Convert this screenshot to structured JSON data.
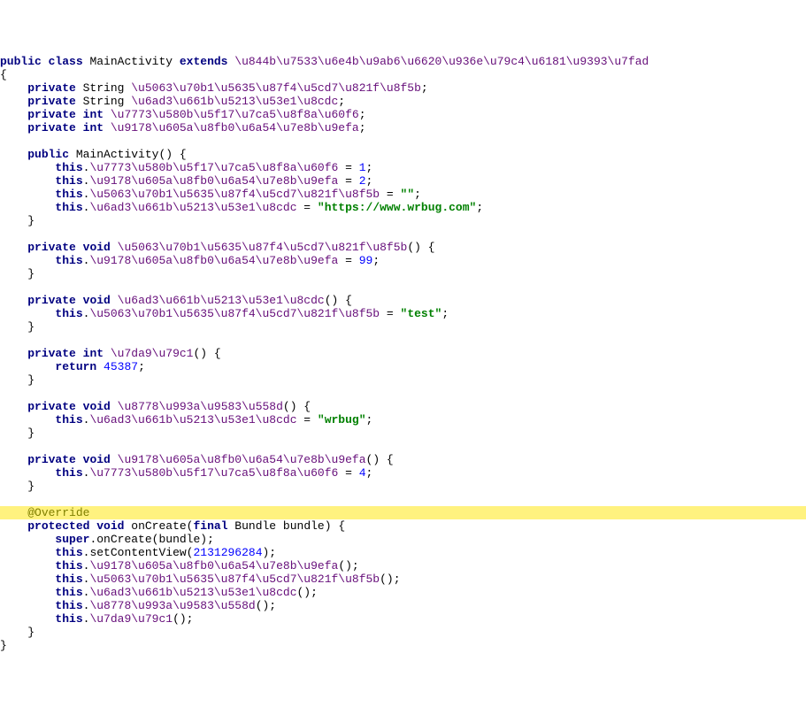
{
  "line1": {
    "kw1": "public",
    "kw2": "class",
    "name": " MainActivity ",
    "kw3": "extends",
    "sp": " ",
    "parent": "\\u844b\\u7533\\u6e4b\\u9ab6\\u6620\\u936e\\u79c4\\u6181\\u9393\\u7fad"
  },
  "line2": {
    "t": "{"
  },
  "line3": {
    "ind": "    ",
    "kw": "private",
    "sp": " String ",
    "id": "\\u5063\\u70b1\\u5635\\u87f4\\u5cd7\\u821f\\u8f5b",
    "end": ";"
  },
  "line4": {
    "ind": "    ",
    "kw": "private",
    "sp": " String ",
    "id": "\\u6ad3\\u661b\\u5213\\u53e1\\u8cdc",
    "end": ";"
  },
  "line5": {
    "ind": "    ",
    "kw1": "private",
    "sp1": " ",
    "kw2": "int",
    "sp2": " ",
    "id": "\\u7773\\u580b\\u5f17\\u7ca5\\u8f8a\\u60f6",
    "end": ";"
  },
  "line6": {
    "ind": "    ",
    "kw1": "private",
    "sp1": " ",
    "kw2": "int",
    "sp2": " ",
    "id": "\\u9178\\u605a\\u8fb0\\u6a54\\u7e8b\\u9efa",
    "end": ";"
  },
  "blank1": " ",
  "line8": {
    "ind": "    ",
    "kw": "public",
    "rest": " MainActivity() {"
  },
  "line9": {
    "ind": "        ",
    "kw": "this",
    "dot": ".",
    "id": "\\u7773\\u580b\\u5f17\\u7ca5\\u8f8a\\u60f6",
    "mid": " = ",
    "num": "1",
    "end": ";"
  },
  "line10": {
    "ind": "        ",
    "kw": "this",
    "dot": ".",
    "id": "\\u9178\\u605a\\u8fb0\\u6a54\\u7e8b\\u9efa",
    "mid": " = ",
    "num": "2",
    "end": ";"
  },
  "line11": {
    "ind": "        ",
    "kw": "this",
    "dot": ".",
    "id": "\\u5063\\u70b1\\u5635\\u87f4\\u5cd7\\u821f\\u8f5b",
    "mid": " = ",
    "str": "\"\"",
    "end": ";"
  },
  "line12": {
    "ind": "        ",
    "kw": "this",
    "dot": ".",
    "id": "\\u6ad3\\u661b\\u5213\\u53e1\\u8cdc",
    "mid": " = ",
    "str": "\"https://www.wrbug.com\"",
    "end": ";"
  },
  "line13": {
    "t": "    }"
  },
  "blank2": " ",
  "line15": {
    "ind": "    ",
    "kw1": "private",
    "sp1": " ",
    "kw2": "void",
    "sp2": " ",
    "id": "\\u5063\\u70b1\\u5635\\u87f4\\u5cd7\\u821f\\u8f5b",
    "end": "() {"
  },
  "line16": {
    "ind": "        ",
    "kw": "this",
    "dot": ".",
    "id": "\\u9178\\u605a\\u8fb0\\u6a54\\u7e8b\\u9efa",
    "mid": " = ",
    "num": "99",
    "end": ";"
  },
  "line17": {
    "t": "    }"
  },
  "blank3": " ",
  "line19": {
    "ind": "    ",
    "kw1": "private",
    "sp1": " ",
    "kw2": "void",
    "sp2": " ",
    "id": "\\u6ad3\\u661b\\u5213\\u53e1\\u8cdc",
    "end": "() {"
  },
  "line20": {
    "ind": "        ",
    "kw": "this",
    "dot": ".",
    "id": "\\u5063\\u70b1\\u5635\\u87f4\\u5cd7\\u821f\\u8f5b",
    "mid": " = ",
    "str": "\"test\"",
    "end": ";"
  },
  "line21": {
    "t": "    }"
  },
  "blank4": " ",
  "line23": {
    "ind": "    ",
    "kw1": "private",
    "sp1": " ",
    "kw2": "int",
    "sp2": " ",
    "id": "\\u7da9\\u79c1",
    "end": "() {"
  },
  "line24": {
    "ind": "        ",
    "kw": "return",
    "sp": " ",
    "num": "45387",
    "end": ";"
  },
  "line25": {
    "t": "    }"
  },
  "blank5": " ",
  "line27": {
    "ind": "    ",
    "kw1": "private",
    "sp1": " ",
    "kw2": "void",
    "sp2": " ",
    "id": "\\u8778\\u993a\\u9583\\u558d",
    "end": "() {"
  },
  "line28": {
    "ind": "        ",
    "kw": "this",
    "dot": ".",
    "id": "\\u6ad3\\u661b\\u5213\\u53e1\\u8cdc",
    "mid": " = ",
    "str": "\"wrbug\"",
    "end": ";"
  },
  "line29": {
    "t": "    }"
  },
  "blank6": " ",
  "line31": {
    "ind": "    ",
    "kw1": "private",
    "sp1": " ",
    "kw2": "void",
    "sp2": " ",
    "id": "\\u9178\\u605a\\u8fb0\\u6a54\\u7e8b\\u9efa",
    "end": "() {"
  },
  "line32": {
    "ind": "        ",
    "kw": "this",
    "dot": ".",
    "id": "\\u7773\\u580b\\u5f17\\u7ca5\\u8f8a\\u60f6",
    "mid": " = ",
    "num": "4",
    "end": ";"
  },
  "line33": {
    "t": "    }"
  },
  "blank7": " ",
  "line35": {
    "ind": "    ",
    "ann": "@Override"
  },
  "line36": {
    "ind": "    ",
    "kw1": "protected",
    "sp1": " ",
    "kw2": "void",
    "mid1": " onCreate(",
    "kw3": "final",
    "mid2": " Bundle bundle) {"
  },
  "line37": {
    "ind": "        ",
    "kw": "super",
    "dot": ".",
    "rest": "onCreate(bundle);"
  },
  "line38": {
    "ind": "        ",
    "kw": "this",
    "dot": ".",
    "rest1": "setContentView(",
    "num": "2131296284",
    "rest2": ");"
  },
  "line39": {
    "ind": "        ",
    "kw": "this",
    "dot": ".",
    "id": "\\u9178\\u605a\\u8fb0\\u6a54\\u7e8b\\u9efa",
    "end": "();"
  },
  "line40": {
    "ind": "        ",
    "kw": "this",
    "dot": ".",
    "id": "\\u5063\\u70b1\\u5635\\u87f4\\u5cd7\\u821f\\u8f5b",
    "end": "();"
  },
  "line41": {
    "ind": "        ",
    "kw": "this",
    "dot": ".",
    "id": "\\u6ad3\\u661b\\u5213\\u53e1\\u8cdc",
    "end": "();"
  },
  "line42": {
    "ind": "        ",
    "kw": "this",
    "dot": ".",
    "id": "\\u8778\\u993a\\u9583\\u558d",
    "end": "();"
  },
  "line43": {
    "ind": "        ",
    "kw": "this",
    "dot": ".",
    "id": "\\u7da9\\u79c1",
    "end": "();"
  },
  "line44": {
    "t": "    }"
  },
  "line45": {
    "t": "}"
  }
}
